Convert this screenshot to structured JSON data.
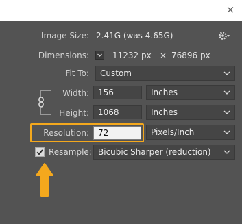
{
  "window": {
    "close_label": "×"
  },
  "image_size": {
    "label": "Image Size:",
    "value": "2.41G (was 4.65G)"
  },
  "dimensions": {
    "label": "Dimensions:",
    "width": "11232 px",
    "times": "×",
    "height": "76896 px"
  },
  "fit_to": {
    "label": "Fit To:",
    "value": "Custom"
  },
  "width": {
    "label": "Width:",
    "value": "156",
    "unit": "Inches"
  },
  "height": {
    "label": "Height:",
    "value": "1068",
    "unit": "Inches"
  },
  "resolution": {
    "label": "Resolution:",
    "value": "72",
    "unit": "Pixels/Inch"
  },
  "resample": {
    "label": "Resample:",
    "checked": true,
    "value": "Bicubic Sharper (reduction)"
  },
  "colors": {
    "highlight": "#f4a81d",
    "arrow": "#f4a81d",
    "background": "#535353"
  },
  "icons": [
    "close-icon",
    "gear-icon",
    "chevron-down-icon",
    "chain-link-icon",
    "checkmark-icon",
    "arrow-up-icon"
  ]
}
